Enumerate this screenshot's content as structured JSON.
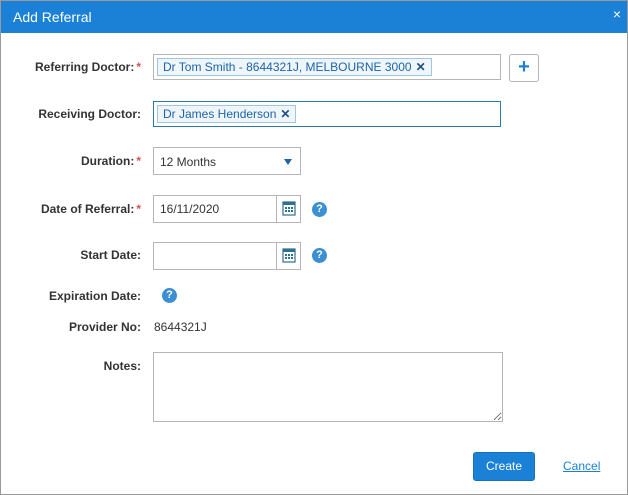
{
  "dialog": {
    "title": "Add Referral",
    "close_glyph": "×"
  },
  "form": {
    "required_marker": "*",
    "referring_doctor": {
      "label": "Referring Doctor:",
      "tag": "Dr Tom Smith - 8644321J, MELBOURNE 3000",
      "remove_glyph": "✕",
      "add_glyph": "+"
    },
    "receiving_doctor": {
      "label": "Receiving Doctor:",
      "tag": "Dr James Henderson",
      "remove_glyph": "✕"
    },
    "duration": {
      "label": "Duration:",
      "value": "12 Months"
    },
    "date_of_referral": {
      "label": "Date of Referral:",
      "value": "16/11/2020"
    },
    "start_date": {
      "label": "Start Date:",
      "value": ""
    },
    "expiration_date": {
      "label": "Expiration Date:"
    },
    "provider_no": {
      "label": "Provider No:",
      "value": "8644321J"
    },
    "notes": {
      "label": "Notes:",
      "value": ""
    },
    "help_glyph": "?"
  },
  "actions": {
    "create": "Create",
    "cancel": "Cancel"
  },
  "colors": {
    "header": "#1a81d6",
    "accent": "#1a81d6",
    "required": "#d9534f",
    "tag_text": "#1f63a8"
  },
  "icons": {
    "close": "close-icon",
    "remove": "remove-tag-icon",
    "add": "plus-icon",
    "dropdown": "chevron-down-icon",
    "calendar": "calendar-icon",
    "help": "help-icon"
  }
}
